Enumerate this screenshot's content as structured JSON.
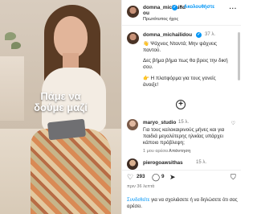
{
  "video": {
    "caption_line1": "Πάμε να",
    "caption_line2": "δούμε μαζί"
  },
  "header": {
    "username_line1": "domna_michailid",
    "username_line2": "ou",
    "separator": "•",
    "follow_label": "Ακολουθήστε",
    "subtitle": "Πρωτότυπος ήχος",
    "more": "···"
  },
  "caption": {
    "username": "domna_michailidou",
    "time": "37 λ.",
    "line1_emoji": "👋",
    "line1_text": " Ψάχνεις Νταντά; Μην ψάχνεις",
    "line2": "παντού.",
    "line3": "Δες βήμα βήμα πως θα βρεις την δική",
    "line4": "σου.",
    "line5": "👉 Η πλατφόρμα για τους γονείς",
    "line6": "άνοιξε!"
  },
  "add_button": "+",
  "comments": [
    {
      "username": "maryo_studio",
      "time": "15 λ.",
      "line1": "Για τους καλοκαιρινούς μήνες και για",
      "line2": "παιδιά μεγαλύτερης ηλικίας υπάρχει",
      "line3": "κάποιο πρόβλεψη;",
      "likes": "1 μου αρέσει",
      "reply": "Απάντηση"
    },
    {
      "username": "pierogoawsithas",
      "time": "15 λ."
    }
  ],
  "actions": {
    "likes_count": "293",
    "comments_count": "9"
  },
  "date": "πριν 36 λεπτά",
  "login": {
    "link": "Συνδεθείτε",
    "text": " για να σχολιάσετε ή να δηλώσετε ότι σας αρέσει."
  },
  "colors": {
    "accent": "#0095f6",
    "text": "#262626",
    "muted": "#737373"
  }
}
